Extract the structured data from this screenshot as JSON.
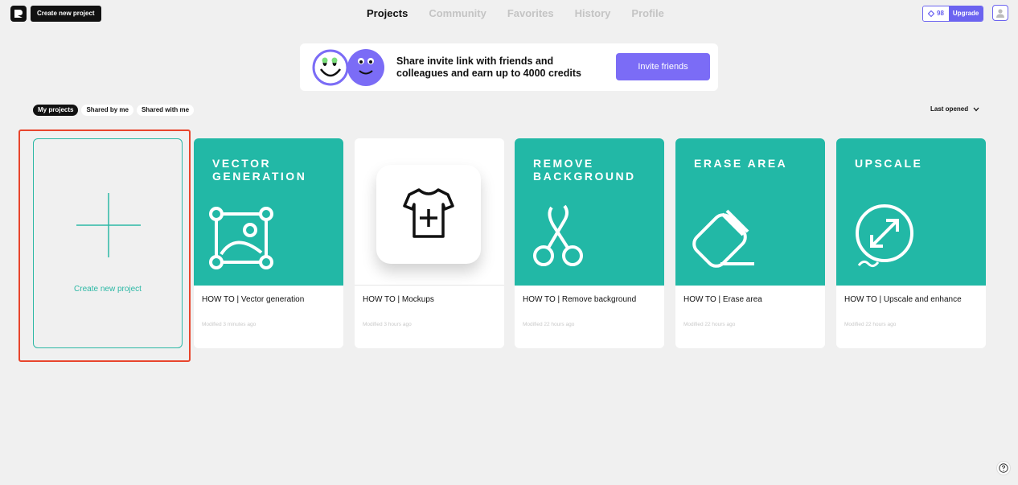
{
  "header": {
    "create_button": "Create new project",
    "nav": [
      {
        "label": "Projects",
        "active": true
      },
      {
        "label": "Community",
        "active": false
      },
      {
        "label": "Favorites",
        "active": false
      },
      {
        "label": "History",
        "active": false
      },
      {
        "label": "Profile",
        "active": false
      }
    ],
    "credits": "98",
    "upgrade": "Upgrade"
  },
  "banner": {
    "text": "Share invite link with friends and colleagues and earn up to 4000 credits",
    "button": "Invite friends"
  },
  "filters": {
    "tabs": [
      {
        "label": "My projects",
        "active": true
      },
      {
        "label": "Shared by me",
        "active": false
      },
      {
        "label": "Shared with me",
        "active": false
      }
    ],
    "sort": "Last opened"
  },
  "new_project": {
    "label": "Create new project"
  },
  "projects": [
    {
      "thumb_title": "VECTOR\nGENERATION",
      "title": "HOW TO | Vector generation",
      "modified": "Modified 3 minutes ago",
      "icon": "image-vector-icon"
    },
    {
      "thumb_title": "",
      "title": "HOW TO | Mockups",
      "modified": "Modified 3 hours ago",
      "icon": "tshirt-plus-icon"
    },
    {
      "thumb_title": "REMOVE\nBACKGROUND",
      "title": "HOW TO | Remove background",
      "modified": "Modified 22 hours ago",
      "icon": "scissors-icon"
    },
    {
      "thumb_title": "ERASE AREA",
      "title": "HOW TO | Erase area",
      "modified": "Modified 22 hours ago",
      "icon": "eraser-icon"
    },
    {
      "thumb_title": "UPSCALE",
      "title": "HOW TO | Upscale and enhance",
      "modified": "Modified 22 hours ago",
      "icon": "upscale-icon"
    }
  ],
  "colors": {
    "accent": "#6b63f0",
    "teal": "#22b8a6",
    "highlight": "#e8452c"
  }
}
